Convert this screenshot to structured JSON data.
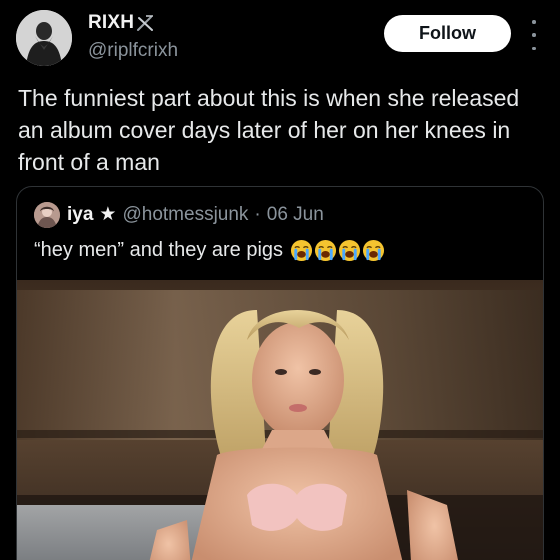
{
  "author": {
    "display_name": "RIXH",
    "handle": "@riplfcrixh",
    "avatar_icon": "person-avatar-icon",
    "badge_icon": "crossed-swords-icon"
  },
  "follow_button": {
    "label": "Follow"
  },
  "more_menu": {
    "icon": "more-vertical-icon"
  },
  "post": {
    "text": "The funniest part about this is when she released an album cover days later of her on her knees in front of a man"
  },
  "quoted_post": {
    "author_name": "iya",
    "name_suffix": "★",
    "handle": "@hotmessjunk",
    "separator": "·",
    "date": "06 Jun",
    "text": "“hey men” and they are pigs",
    "emojis": [
      "loudly-crying-face-icon",
      "loudly-crying-face-icon",
      "loudly-crying-face-icon",
      "loudly-crying-face-icon"
    ],
    "media": {
      "type": "photo",
      "description_icon": "photo-thumbnail"
    }
  },
  "colors": {
    "background": "#000000",
    "text_primary": "#e7e9ea",
    "text_secondary": "#8b949c",
    "border": "#2f3336",
    "follow_bg": "#ffffff",
    "follow_text": "#0f1419"
  }
}
